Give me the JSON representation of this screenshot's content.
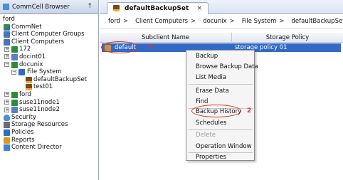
{
  "left_panel": {
    "header_title": "CommCell Browser",
    "pin_glyph": "↑",
    "tree": [
      {
        "label": "ford",
        "icon": "none"
      },
      {
        "label": "CommNet",
        "icon": "commnet-icon"
      },
      {
        "label": "Client Computer Groups",
        "icon": "client-groups-icon"
      },
      {
        "label": "Client Computers",
        "icon": "client-computers-icon"
      },
      {
        "label": "172",
        "icon": "client-icon"
      },
      {
        "label": "docint01",
        "icon": "client-icon"
      },
      {
        "label": "docunix",
        "icon": "client-icon"
      },
      {
        "label": "File System",
        "icon": "file-system-icon"
      },
      {
        "label": "defaultBackupSet",
        "icon": "backupset-icon"
      },
      {
        "label": "test01",
        "icon": "backupset-icon"
      },
      {
        "label": "ford",
        "icon": "client-icon"
      },
      {
        "label": "suse11node1",
        "icon": "client-icon"
      },
      {
        "label": "suse11node2",
        "icon": "client-icon"
      },
      {
        "label": "Security",
        "icon": "security-icon"
      },
      {
        "label": "Storage Resources",
        "icon": "storage-icon"
      },
      {
        "label": "Policies",
        "icon": "policies-icon"
      },
      {
        "label": "Reports",
        "icon": "reports-icon"
      },
      {
        "label": "Content Director",
        "icon": "content-director-icon"
      }
    ]
  },
  "tab": {
    "label": "defaultBackupSet",
    "close_glyph": "×"
  },
  "breadcrumb": {
    "items": [
      "ford",
      "Client Computers",
      "docunix",
      "File System",
      "defaultBackupSet"
    ],
    "separator": ">"
  },
  "table": {
    "columns": [
      "Subclient Name",
      "Storage Policy"
    ],
    "rows": [
      {
        "subclient": "default",
        "storage_policy": "storage policy 01"
      }
    ]
  },
  "annotations": {
    "step1": "1",
    "step2": "2",
    "color": "#d9362c"
  },
  "context_menu": {
    "items": [
      "Backup",
      "Browse Backup Data",
      "List Media",
      "Erase Data",
      "Find",
      "Backup History",
      "Schedules",
      "Delete",
      "Operation Window",
      "Properties"
    ],
    "disabled": [
      "Delete"
    ],
    "highlighted": "Backup History"
  },
  "colors": {
    "selection": "#316ac5",
    "accent": "#d9362c"
  }
}
